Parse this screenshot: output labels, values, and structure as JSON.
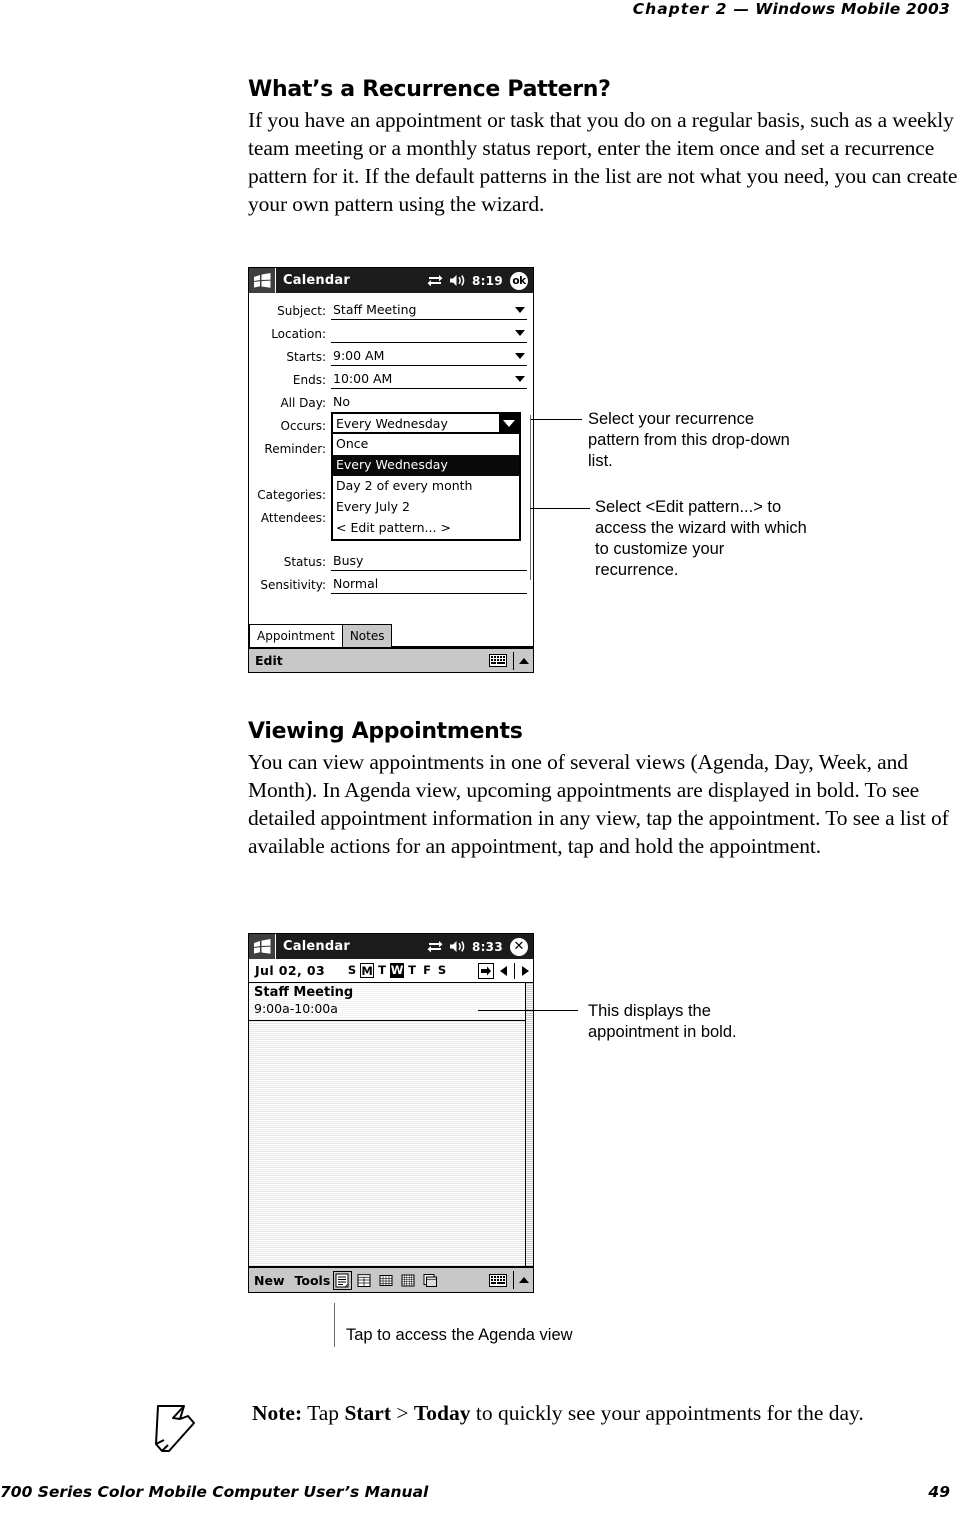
{
  "header": {
    "chapter": "Chapter  2",
    "dash": "—",
    "title": "Windows Mobile 2003"
  },
  "sections": [
    {
      "heading": "What’s a Recurrence Pattern?",
      "body": "If you have an appointment or task that you do on a regular basis, such as a weekly team meeting or a monthly status report, enter the item once and set a recurrence pattern for it. If the default patterns in the list are not what you need, you can create your own pattern using the wizard."
    },
    {
      "heading": "Viewing Appointments",
      "body": "You can view appointments in one of several views (Agenda, Day, Week, and Month). In Agenda view, upcoming appointments are displayed in bold. To see detailed appointment information in any view, tap the appointment. To see a list of available actions for an appointment, tap and hold the appointment."
    }
  ],
  "screenshot_appointment": {
    "titlebar": {
      "app_name": "Calendar",
      "time": "8:19",
      "ok_label": "ok"
    },
    "fields": [
      {
        "label": "Subject:",
        "value": "Staff Meeting",
        "caret": true
      },
      {
        "label": "Location:",
        "value": "",
        "caret": true
      },
      {
        "label": "Starts:",
        "value": "9:00 AM",
        "caret": true
      },
      {
        "label": "Ends:",
        "value": "10:00 AM",
        "caret": true
      },
      {
        "label": "All Day:",
        "value": "No",
        "caret": false
      },
      {
        "label": "Occurs:",
        "value": "Every Wednesday",
        "caret": false
      },
      {
        "label": "Reminder:",
        "value": "",
        "caret": false
      },
      {
        "label": "Categories:",
        "value": "",
        "caret": false
      },
      {
        "label": "Attendees:",
        "value": "",
        "caret": false
      },
      {
        "label": "Status:",
        "value": "Busy",
        "caret": false
      },
      {
        "label": "Sensitivity:",
        "value": "Normal",
        "caret": false
      }
    ],
    "dropdown": {
      "selected": "Every Wednesday",
      "options": [
        "Once",
        "Every Wednesday",
        "Day 2 of every month",
        "Every July 2",
        "< Edit pattern... >"
      ],
      "highlighted_index": 1
    },
    "tabs": [
      {
        "label": "Appointment",
        "active": true
      },
      {
        "label": "Notes",
        "active": false
      }
    ],
    "command_bar": {
      "label": "Edit"
    }
  },
  "callouts": {
    "recurrence": "Select your recurrence pattern from this drop-down list.",
    "edit_pattern": "Select <Edit pattern...> to access the wizard with which to customize your recurrence.",
    "bold_appointment": "This displays the appointment in bold.",
    "agenda_view": "Tap to access the Agenda view"
  },
  "screenshot_agenda": {
    "titlebar": {
      "app_name": "Calendar",
      "time": "8:33"
    },
    "date": "Jul  02, 03",
    "days": [
      {
        "letter": "S",
        "state": "normal"
      },
      {
        "letter": "M",
        "state": "outline"
      },
      {
        "letter": "T",
        "state": "normal"
      },
      {
        "letter": "W",
        "state": "filled"
      },
      {
        "letter": "T",
        "state": "normal"
      },
      {
        "letter": "F",
        "state": "normal"
      },
      {
        "letter": "S",
        "state": "normal"
      }
    ],
    "appointment": {
      "title": "Staff Meeting",
      "time": "9:00a-10:00a"
    },
    "toolbar": {
      "new_label": "New",
      "tools_label": "Tools",
      "buttons": [
        "agenda-view-icon",
        "day-view-icon",
        "week-view-icon",
        "month-view-icon",
        "year-view-icon"
      ],
      "selected_index": 0
    }
  },
  "note": {
    "prefix": "Note:",
    "text_1": " Tap ",
    "bold_1": "Start",
    "text_2": " > ",
    "bold_2": "Today",
    "text_3": " to quickly see your appointments for the day."
  },
  "footer": {
    "title": "700 Series Color Mobile Computer User’s Manual",
    "page": "49"
  }
}
